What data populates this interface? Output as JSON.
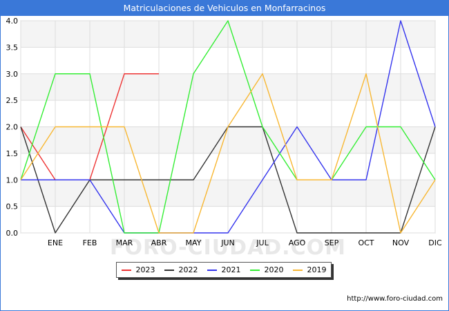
{
  "title": "Matriculaciones de Vehiculos en Monfarracinos",
  "watermark": "FORO-CIUDAD.COM",
  "source_url": "http://www.foro-ciudad.com",
  "chart_data": {
    "type": "line",
    "categories": [
      "",
      "ENE",
      "FEB",
      "MAR",
      "ABR",
      "MAY",
      "JUN",
      "JUL",
      "AGO",
      "SEP",
      "OCT",
      "NOV",
      "DIC"
    ],
    "ylim": [
      0,
      4
    ],
    "yticks": [
      "0.0",
      "0.5",
      "1.0",
      "1.5",
      "2.0",
      "2.5",
      "3.0",
      "3.5",
      "4.0"
    ],
    "grid": true,
    "legend_position": "bottom",
    "series": [
      {
        "name": "2023",
        "color": "#ee3333",
        "values": [
          2,
          1,
          1,
          3,
          3
        ]
      },
      {
        "name": "2022",
        "color": "#333333",
        "values": [
          2,
          0,
          1,
          1,
          1,
          1,
          2,
          2,
          0,
          0,
          0,
          0,
          2
        ]
      },
      {
        "name": "2021",
        "color": "#3333ee",
        "values": [
          1,
          1,
          1,
          0,
          0,
          0,
          0,
          1,
          2,
          1,
          1,
          4,
          2
        ]
      },
      {
        "name": "2020",
        "color": "#33ee33",
        "values": [
          1,
          3,
          3,
          0,
          0,
          3,
          4,
          2,
          1,
          1,
          2,
          2,
          1
        ]
      },
      {
        "name": "2019",
        "color": "#f8b732",
        "values": [
          1,
          2,
          2,
          2,
          0,
          0,
          2,
          3,
          1,
          1,
          3,
          0,
          1
        ]
      }
    ]
  }
}
